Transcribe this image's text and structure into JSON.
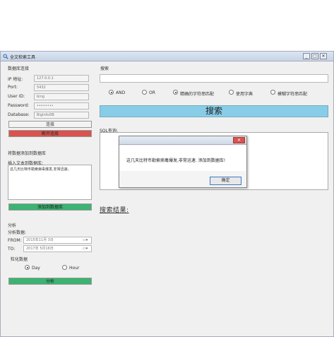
{
  "window": {
    "title": "全文检索工具",
    "minimize": "_",
    "maximize": "□",
    "close": "✕"
  },
  "db_connection": {
    "section_label": "数据库连接",
    "fields": [
      {
        "label": "IP 地址:",
        "value": "127.0.0.1"
      },
      {
        "label": "Port:",
        "value": "5432"
      },
      {
        "label": "User ID:",
        "value": "bing"
      },
      {
        "label": "Password:",
        "value": "••••••••"
      },
      {
        "label": "Database:",
        "value": "BigInfoDB"
      }
    ],
    "connect_label": "连接",
    "disconnect_label": "断开连接"
  },
  "add_data": {
    "section_label": "将数据添加到数据库",
    "insert_label": "插入文本到数据库:",
    "text": "这几天比特币勒索病毒爆发,非常迅速。",
    "add_button": "添加到数据库"
  },
  "analysis": {
    "section_label": "分析",
    "data_label": "分析数据:",
    "from_label": "FROM:",
    "from_value": "2015年11月  3日",
    "to_label": "TO:",
    "to_value": "2017年  5月16日",
    "granularity_label": "粒化数据",
    "options": [
      {
        "label": "Day",
        "selected": true
      },
      {
        "label": "Hour",
        "selected": false
      }
    ],
    "analyze_button": "分析"
  },
  "search": {
    "section_label": "搜索",
    "input_value": "",
    "options": [
      {
        "label": "AND",
        "selected": true
      },
      {
        "label": "OR",
        "selected": false
      },
      {
        "label": "精确的字符串匹配",
        "selected": true
      },
      {
        "label": "使用字典",
        "selected": false
      },
      {
        "label": "模糊字符串匹配",
        "selected": false
      }
    ],
    "search_button": "搜索",
    "sql_label": "SQL查询:",
    "results_label": "搜索结果:"
  },
  "dialog": {
    "message": "这几天比特币勒索病毒爆发,非常迅速. 添加到数据库!",
    "ok_button": "确定",
    "close": "✕"
  },
  "colors": {
    "disconnect_red": "#d9534f",
    "add_green": "#3cb371",
    "search_blue": "#87cde8",
    "dialog_close_red": "#d9534f"
  }
}
